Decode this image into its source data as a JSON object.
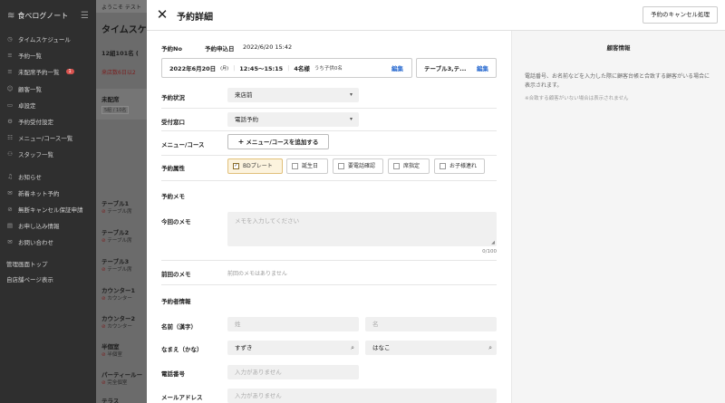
{
  "sidebar": {
    "brand": "食べログノート",
    "items": [
      {
        "icon": "clock-icon",
        "label": "タイムスケジュール"
      },
      {
        "icon": "list-icon",
        "label": "予約一覧"
      },
      {
        "icon": "list-icon",
        "label": "未配席予約一覧",
        "badge": "1"
      },
      {
        "icon": "user-icon",
        "label": "顧客一覧"
      },
      {
        "icon": "seat-icon",
        "label": "卓設定"
      },
      {
        "icon": "gear-icon",
        "label": "予約受付設定"
      },
      {
        "icon": "menu-icon",
        "label": "メニュー/コース一覧"
      },
      {
        "icon": "staff-icon",
        "label": "スタッフ一覧"
      },
      {
        "icon": "bell-icon",
        "label": "お知らせ"
      },
      {
        "icon": "net-icon",
        "label": "新着ネット予約"
      },
      {
        "icon": "cancel-icon",
        "label": "無断キャンセル保証申請"
      },
      {
        "icon": "document-icon",
        "label": "お申し込み情報"
      },
      {
        "icon": "mail-icon",
        "label": "お問い合わせ"
      }
    ],
    "footer_links": [
      "管理画面トップ",
      "自店舗ページ表示"
    ]
  },
  "background": {
    "welcome": "ようこそ テスト",
    "title": "タイムスケ",
    "count": "12組101名 (",
    "alert": "来店数6日以2",
    "unassigned": {
      "label": "未配席",
      "sub": "5組 / 10名"
    },
    "tables": [
      {
        "name": "テーブル1",
        "status": "テーブル席"
      },
      {
        "name": "テーブル2",
        "status": "テーブル席"
      },
      {
        "name": "テーブル3",
        "status": "テーブル席"
      },
      {
        "name": "カウンター1",
        "status": "カウンター"
      },
      {
        "name": "カウンター2",
        "status": "カウンター"
      },
      {
        "name": "半個室",
        "status": "半個室"
      },
      {
        "name": "パーティールー",
        "status": "完全個室"
      },
      {
        "name": "テラス",
        "status": ""
      }
    ]
  },
  "modal": {
    "title": "予約詳細",
    "cancel_button": "予約のキャンセル処理",
    "reservation_no_label": "予約No",
    "applied_label": "予約申込日",
    "applied_value": "2022/6/20 15:42",
    "date": "2022年6月20日",
    "weekday": "(月)",
    "time": "12:45〜15:15",
    "people": "4名様",
    "children": "うち子供0名",
    "edit": "編集",
    "table": "テーブル3,テ...",
    "status_label": "予約状況",
    "status_value": "来店前",
    "channel_label": "受付窓口",
    "channel_value": "電話予約",
    "menu_label": "メニュー/コース",
    "menu_button": "メニュー/コースを追加する",
    "attr_label": "予約属性",
    "attributes": [
      {
        "label": "BDプレート",
        "checked": true
      },
      {
        "label": "誕生日",
        "checked": false
      },
      {
        "label": "要電話確認",
        "checked": false
      },
      {
        "label": "席指定",
        "checked": false
      },
      {
        "label": "お子様連れ",
        "checked": false
      }
    ],
    "memo_section": "予約メモ",
    "memo_label": "今回のメモ",
    "memo_placeholder": "メモを入力してください",
    "memo_counter": "0/100",
    "prev_memo_label": "前回のメモ",
    "prev_memo_value": "前回のメモはありません",
    "booker_section": "予約者情報",
    "name_label": "名前（漢字）",
    "last_name_placeholder": "姓",
    "first_name_placeholder": "名",
    "kana_label": "なまえ（かな）",
    "last_kana": "すずき",
    "first_kana": "はなこ",
    "phone_label": "電話番号",
    "phone_placeholder": "入力がありません",
    "email_label": "メールアドレス",
    "email_placeholder": "入力がありません"
  },
  "customer_panel": {
    "title": "顧客情報",
    "description": "電話番号、お名前などを入力した際に顧客台帳と合致する顧客がいる場合に表示されます。",
    "note": "※合致する顧客がいない場合は表示されません"
  }
}
